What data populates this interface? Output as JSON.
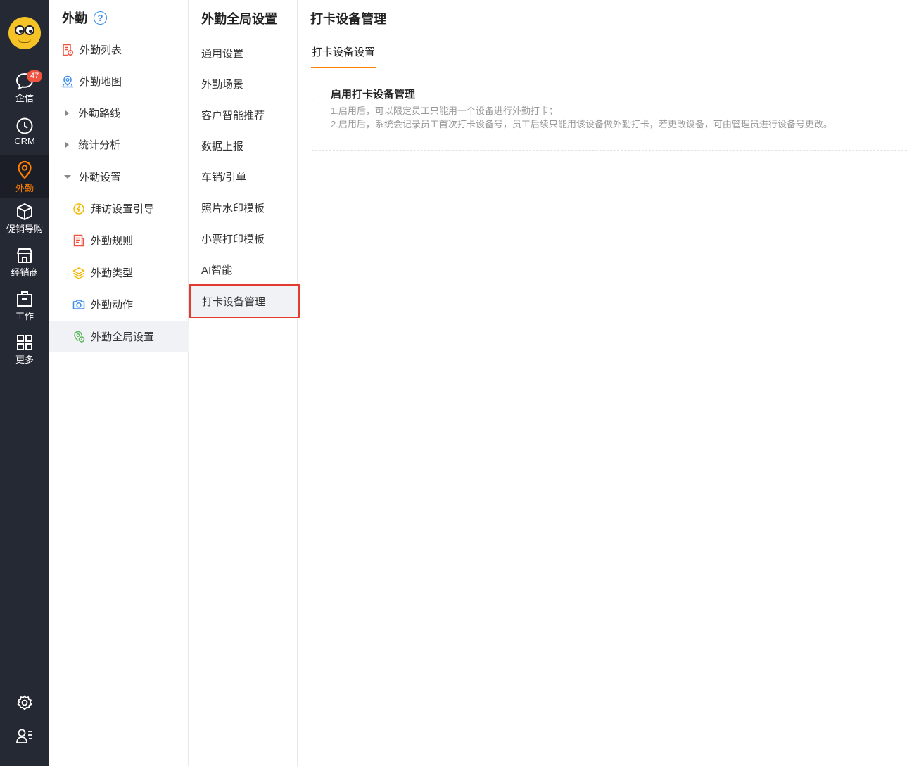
{
  "rail": {
    "items": [
      {
        "label": "企信",
        "icon": "chat-icon",
        "badge": "47"
      },
      {
        "label": "CRM",
        "icon": "clock-icon"
      },
      {
        "label": "外勤",
        "icon": "location-pin-icon",
        "active": true
      },
      {
        "label": "促销导购",
        "icon": "box-icon"
      },
      {
        "label": "经销商",
        "icon": "store-icon"
      },
      {
        "label": "工作",
        "icon": "briefcase-icon"
      },
      {
        "label": "更多",
        "icon": "grid-icon"
      }
    ],
    "bottom_icons": [
      "settings-gear-icon",
      "user-list-icon"
    ],
    "accent_color": "#ff8000",
    "bg_color": "#252934"
  },
  "nav2": {
    "title": "外勤",
    "help_icon_text": "?",
    "items": [
      {
        "label": "外勤列表",
        "icon": "list-doc-icon"
      },
      {
        "label": "外勤地图",
        "icon": "map-pin-icon"
      },
      {
        "label": "外勤路线",
        "icon": "caret-right-icon"
      },
      {
        "label": "统计分析",
        "icon": "caret-right-icon"
      },
      {
        "label": "外勤设置",
        "icon": "caret-down-icon"
      },
      {
        "label": "拜访设置引导",
        "icon": "lightbulb-icon"
      },
      {
        "label": "外勤规则",
        "icon": "rule-doc-icon"
      },
      {
        "label": "外勤类型",
        "icon": "layers-icon"
      },
      {
        "label": "外勤动作",
        "icon": "camera-icon"
      },
      {
        "label": "外勤全局设置",
        "icon": "global-settings-icon",
        "active": true
      }
    ]
  },
  "nav3": {
    "title": "外勤全局设置",
    "items": [
      {
        "label": "通用设置"
      },
      {
        "label": "外勤场景"
      },
      {
        "label": "客户智能推荐"
      },
      {
        "label": "数据上报"
      },
      {
        "label": "车销/引单"
      },
      {
        "label": "照片水印模板"
      },
      {
        "label": "小票打印模板"
      },
      {
        "label": "AI智能"
      },
      {
        "label": "打卡设备管理",
        "active": true
      }
    ]
  },
  "main": {
    "title": "打卡设备管理",
    "tab": "打卡设备设置",
    "setting": {
      "title": "启用打卡设备管理",
      "checked": false,
      "desc1": "1.启用后，可以限定员工只能用一个设备进行外勤打卡；",
      "desc2": "2.启用后，系统会记录员工首次打卡设备号，员工后续只能用该设备做外勤打卡，若更改设备，可由管理员进行设备号更改。"
    }
  }
}
